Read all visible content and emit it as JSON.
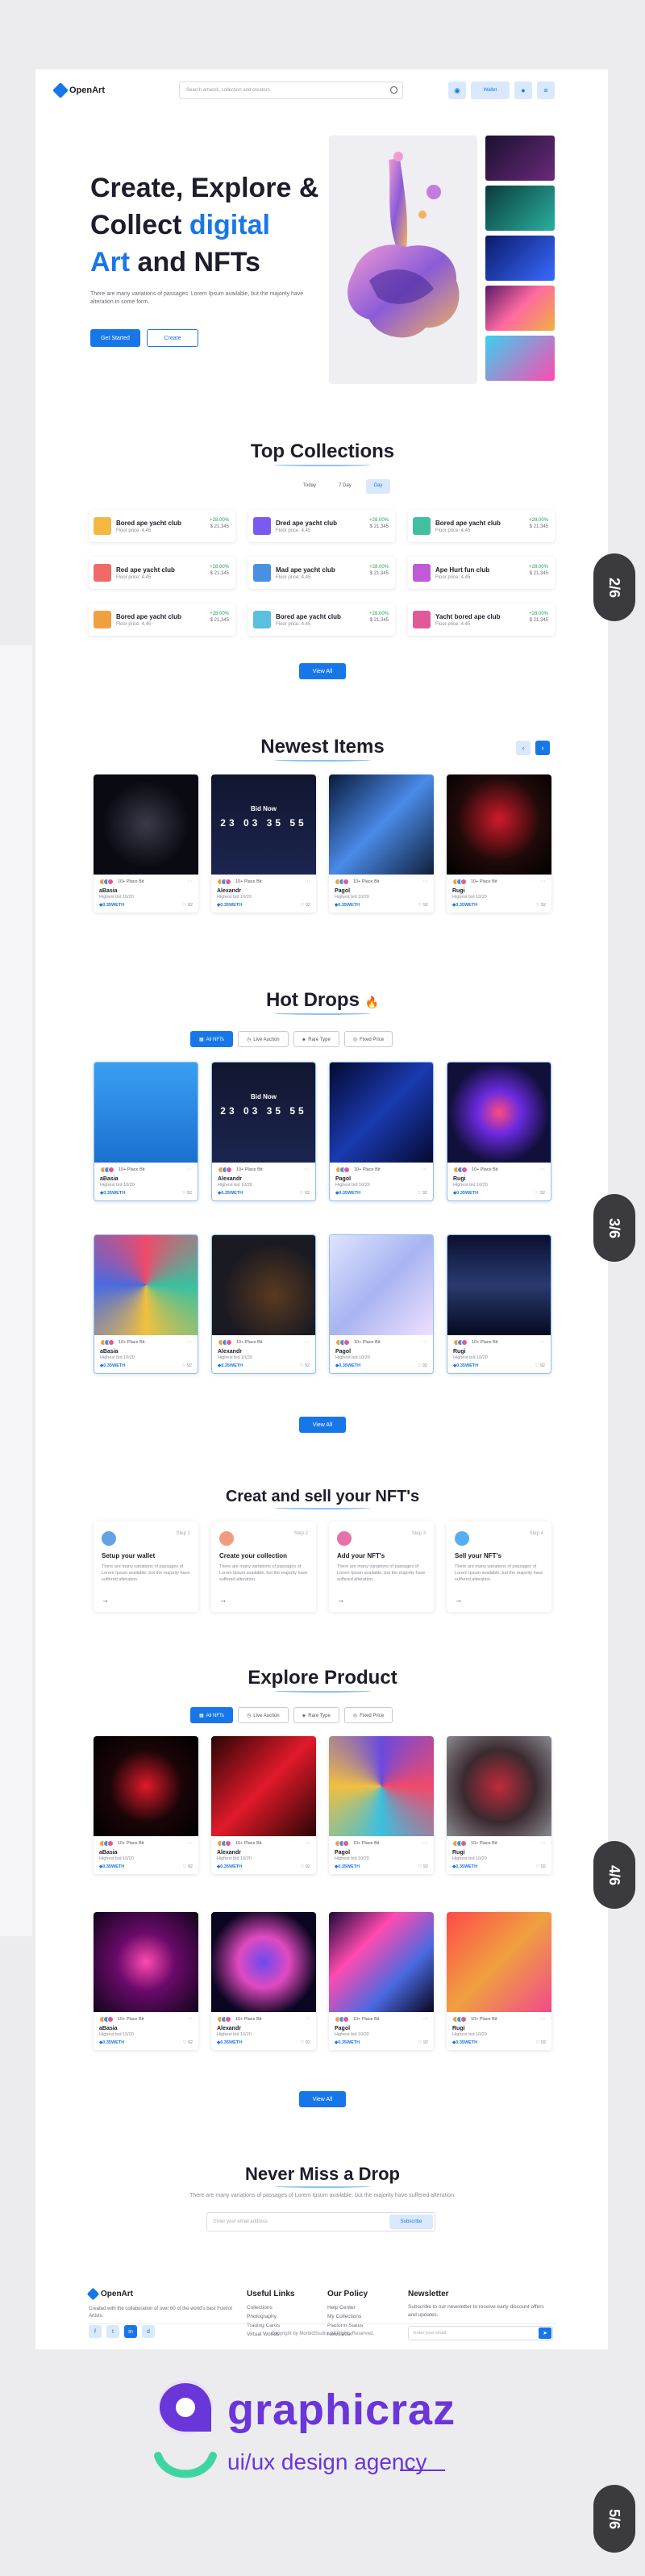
{
  "header": {
    "brand": "OpenArt",
    "search_placeholder": "Search artwork, collection and creators",
    "wallet_label": "Wallet"
  },
  "hero": {
    "title_line1": "Create, Explore &",
    "title_line2_a": "Collect ",
    "title_line2_b": "digital",
    "title_line3_a": "Art",
    "title_line3_b": " and NFTs",
    "description": "There are many variations of passages. Lorem Ipsum available, but the majority have alteration in some form.",
    "get_started": "Get Started",
    "create": "Create"
  },
  "top_collections": {
    "title": "Top Collections",
    "tabs": [
      "Today",
      "7 Day",
      "Day"
    ],
    "items": [
      {
        "name": "Bored ape yacht club",
        "floor": "Floor price: 4.45",
        "pct": "+28.00%",
        "val": "$ 21,345"
      },
      {
        "name": "Dred ape yacht club",
        "floor": "Floor price: 4.45",
        "pct": "+28.00%",
        "val": "$ 21,345"
      },
      {
        "name": "Bored ape yacht club",
        "floor": "Floor price: 4.45",
        "pct": "+28.00%",
        "val": "$ 21,345"
      },
      {
        "name": "Red ape yacht club",
        "floor": "Floor price: 4.45",
        "pct": "+28.00%",
        "val": "$ 21,345"
      },
      {
        "name": "Mad ape yacht club",
        "floor": "Floor price: 4.45",
        "pct": "+28.00%",
        "val": "$ 21,345"
      },
      {
        "name": "Ape Hurt fun club",
        "floor": "Floor price: 4.45",
        "pct": "+28.00%",
        "val": "$ 21,345"
      },
      {
        "name": "Bored ape yacht club",
        "floor": "Floor price: 4.45",
        "pct": "+28.00%",
        "val": "$ 21,345"
      },
      {
        "name": "Bored ape yacht club",
        "floor": "Floor price: 4.45",
        "pct": "+28.00%",
        "val": "$ 21,345"
      },
      {
        "name": "Yacht bored ape club",
        "floor": "Floor price: 4.45",
        "pct": "+28.00%",
        "val": "$ 21,345"
      }
    ],
    "view_all": "View All"
  },
  "newest": {
    "title": "Newest Items",
    "cards": [
      {
        "owner": "10+ Place Bit",
        "name": "aBasia",
        "sub": "Highest bid 10/20",
        "price": "0.35WETH",
        "likes": "92"
      },
      {
        "owner": "10+ Place Bit",
        "name": "Alexandr",
        "sub": "Highest bid 10/20",
        "price": "0.35WETH",
        "likes": "92",
        "cd_title": "Bid Now",
        "cd_nums": "23 03 35 55"
      },
      {
        "owner": "10+ Place Bit",
        "name": "Pagol",
        "sub": "Highest bid 10/20",
        "price": "0.35WETH",
        "likes": "92"
      },
      {
        "owner": "10+ Place Bit",
        "name": "Rugi",
        "sub": "Highest bid 10/20",
        "price": "0.35WETH",
        "likes": "92"
      }
    ]
  },
  "hot_drops": {
    "title": "Hot Drops",
    "emoji": "🔥",
    "filters": [
      "All NFTs",
      "Live Auction",
      "Rare Type",
      "Fixed Price"
    ],
    "cards": [
      {
        "owner": "10+ Place Bit",
        "name": "aBasia",
        "sub": "Highest bid 10/20",
        "price": "0.35WETH",
        "likes": "92"
      },
      {
        "owner": "10+ Place Bit",
        "name": "Alexandr",
        "sub": "Highest bid 10/20",
        "price": "0.35WETH",
        "likes": "92",
        "cd_title": "Bid Now",
        "cd_nums": "23 03 35 55"
      },
      {
        "owner": "10+ Place Bit",
        "name": "Pagol",
        "sub": "Highest bid 10/20",
        "price": "0.35WETH",
        "likes": "92"
      },
      {
        "owner": "10+ Place Bit",
        "name": "Rugi",
        "sub": "Highest bid 10/20",
        "price": "0.35WETH",
        "likes": "92"
      },
      {
        "owner": "10+ Place Bit",
        "name": "aBasia",
        "sub": "Highest bid 10/20",
        "price": "0.35WETH",
        "likes": "92"
      },
      {
        "owner": "10+ Place Bit",
        "name": "Alexandr",
        "sub": "Highest bid 10/20",
        "price": "0.35WETH",
        "likes": "92"
      },
      {
        "owner": "10+ Place Bit",
        "name": "Pagol",
        "sub": "Highest bid 10/20",
        "price": "0.35WETH",
        "likes": "92"
      },
      {
        "owner": "10+ Place Bit",
        "name": "Rugi",
        "sub": "Highest bid 10/20",
        "price": "0.35WETH",
        "likes": "92"
      }
    ],
    "view_all": "View All"
  },
  "create_sell": {
    "title": "Creat and sell your NFT's",
    "steps": [
      {
        "no": "Step 1",
        "title": "Setup your wallet",
        "desc": "There are many variations of passages of Lorem Ipsum available, but the majority have suffered alteration."
      },
      {
        "no": "Step 2",
        "title": "Create your collection",
        "desc": "There are many variations of passages of Lorem Ipsum available, but the majority have suffered alteration."
      },
      {
        "no": "Step 3",
        "title": "Add your NFT's",
        "desc": "There are many variations of passages of Lorem Ipsum available, but the majority have suffered alteration."
      },
      {
        "no": "Step 4",
        "title": "Sell your NFT's",
        "desc": "There are many variations of passages of Lorem Ipsum available, but the majority have suffered alteration."
      }
    ]
  },
  "explore": {
    "title": "Explore Product",
    "filters": [
      "All NFTs",
      "Live Auction",
      "Rare Type",
      "Fixed Price"
    ],
    "cards": [
      {
        "owner": "10+ Place Bit",
        "name": "aBasia",
        "sub": "Highest bid 10/20",
        "price": "0.35WETH",
        "likes": "92"
      },
      {
        "owner": "10+ Place Bit",
        "name": "Alexandr",
        "sub": "Highest bid 10/20",
        "price": "0.35WETH",
        "likes": "92"
      },
      {
        "owner": "10+ Place Bit",
        "name": "Pagol",
        "sub": "Highest bid 10/20",
        "price": "0.35WETH",
        "likes": "92"
      },
      {
        "owner": "10+ Place Bit",
        "name": "Rugi",
        "sub": "Highest bid 10/20",
        "price": "0.35WETH",
        "likes": "92"
      },
      {
        "owner": "10+ Place Bit",
        "name": "aBasia",
        "sub": "Highest bid 10/20",
        "price": "0.35WETH",
        "likes": "92"
      },
      {
        "owner": "10+ Place Bit",
        "name": "Alexandr",
        "sub": "Highest bid 10/20",
        "price": "0.35WETH",
        "likes": "92"
      },
      {
        "owner": "10+ Place Bit",
        "name": "Pagol",
        "sub": "Highest bid 10/20",
        "price": "0.35WETH",
        "likes": "92"
      },
      {
        "owner": "10+ Place Bit",
        "name": "Rugi",
        "sub": "Highest bid 10/20",
        "price": "0.35WETH",
        "likes": "92"
      }
    ],
    "view_all": "View All"
  },
  "newsletter": {
    "title": "Never Miss a Drop",
    "desc": "There are many variations of passages of Lorem Ipsum available, but the majority have suffered alteration.",
    "placeholder": "Enter your email address",
    "button": "Subscribe"
  },
  "footer": {
    "brand": "OpenArt",
    "desc": "Created with the collaboration of over 60 of the world's best Foxtrot Artists.",
    "social": [
      "f",
      "t",
      "in",
      "d"
    ],
    "col1_title": "Useful Links",
    "col1": [
      "Collections",
      "Photography",
      "Trading Cards",
      "Virtual Worlds"
    ],
    "col2_title": "Our Policy",
    "col2": [
      "Help Center",
      "My Collections",
      "Platform Status",
      "Newsletter"
    ],
    "col3_title": "Newsletter",
    "col3_desc": "Subscribe to our newsletter to receive early discount offers and updates.",
    "col3_placeholder": "Enter your email",
    "copyright": "Copyright by MorbidStudio. All Rights Reserved."
  },
  "brand": {
    "name": "graphicraz",
    "tagline": "ui/ux design agency"
  },
  "page_badges": [
    "2/6",
    "3/6",
    "4/6",
    "5/6"
  ],
  "colors": {
    "accent": "#1877e8",
    "brand_purple": "#6a35d9",
    "badge": "#3a3a3f"
  }
}
